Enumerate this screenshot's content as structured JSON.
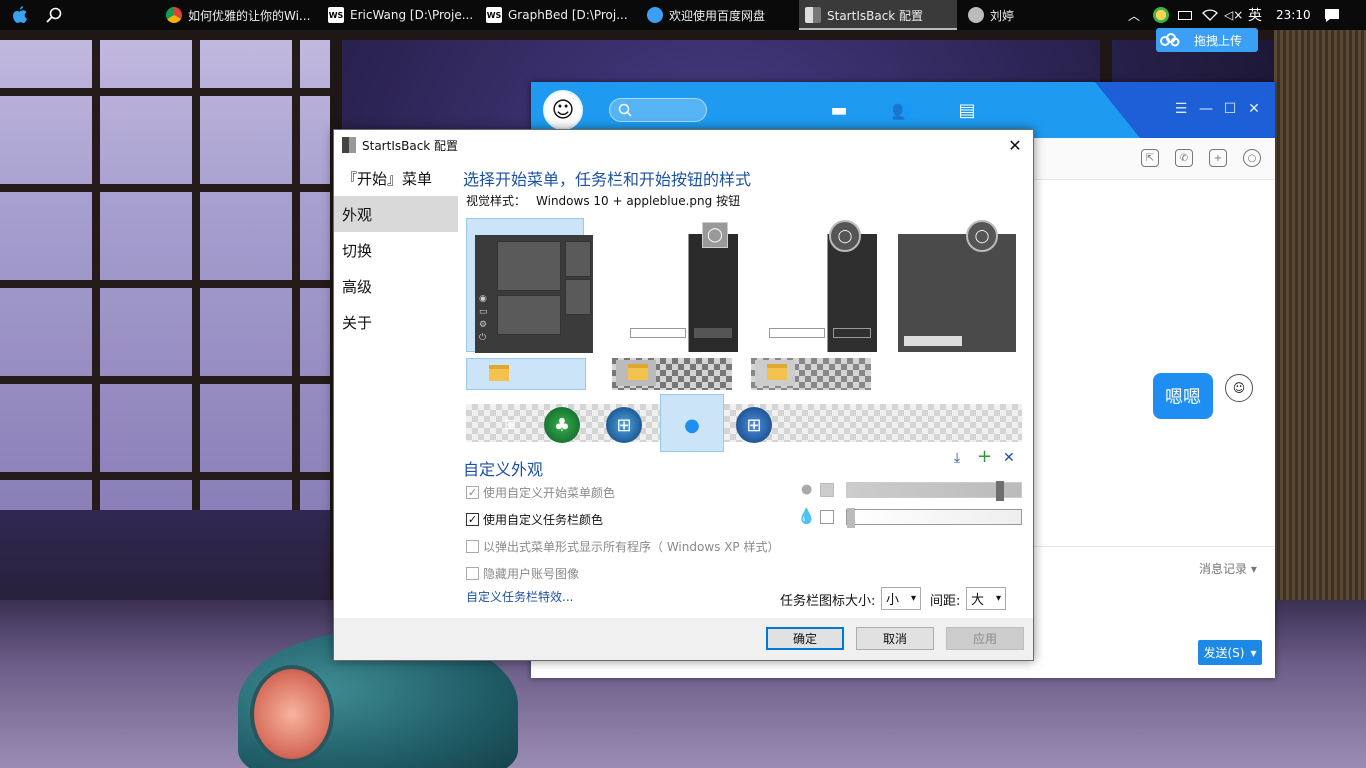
{
  "taskbar": {
    "tasks": [
      {
        "label": "如何优雅的让你的Wi...",
        "icon": "chrome-icon"
      },
      {
        "label": "EricWang [D:\\Proje...",
        "icon": "webstorm-icon"
      },
      {
        "label": "GraphBed [D:\\Proj...",
        "icon": "webstorm-icon"
      },
      {
        "label": "欢迎使用百度网盘",
        "icon": "baidu-netdisk-icon"
      },
      {
        "label": "StartIsBack 配置",
        "icon": "startisback-icon"
      },
      {
        "label": "刘婷",
        "icon": "qq-icon"
      }
    ],
    "ime": "英",
    "clock": "23:10"
  },
  "upload_widget": {
    "label": "拖拽上传"
  },
  "qq": {
    "message": "嗯嗯",
    "history_label": "消息记录",
    "send_label": "发送(S)"
  },
  "dialog": {
    "title": "StartIsBack 配置",
    "sidebar": [
      {
        "label": "『开始』菜单",
        "selected": false
      },
      {
        "label": "外观",
        "selected": true
      },
      {
        "label": "切换",
        "selected": false
      },
      {
        "label": "高级",
        "selected": false
      },
      {
        "label": "关于",
        "selected": false
      }
    ],
    "heading": "选择开始菜单，任务栏和开始按钮的样式",
    "visual_style_label": "视觉样式：",
    "visual_style_value": "Windows 10 + appleblue.png 按钮",
    "custom_heading": "自定义外观",
    "options": [
      {
        "label": "使用自定义开始菜单颜色",
        "checked": true,
        "enabled": false
      },
      {
        "label": "使用自定义任务栏颜色",
        "checked": true,
        "enabled": true
      },
      {
        "label": "以弹出式菜单形式显示所有程序（ Windows XP 样式）",
        "checked": false,
        "enabled": false
      },
      {
        "label": "隐藏用户账号图像",
        "checked": false,
        "enabled": false
      }
    ],
    "start_menu_opacity": 0.9,
    "taskbar_opacity": 0.0,
    "taskbar_effects_link": "自定义任务栏特效...",
    "icon_size_label": "任务栏图标大小:",
    "icon_size_value": "小",
    "spacing_label": "间距:",
    "spacing_value": "大",
    "buttons": {
      "ok": "确定",
      "cancel": "取消",
      "apply": "应用"
    }
  }
}
